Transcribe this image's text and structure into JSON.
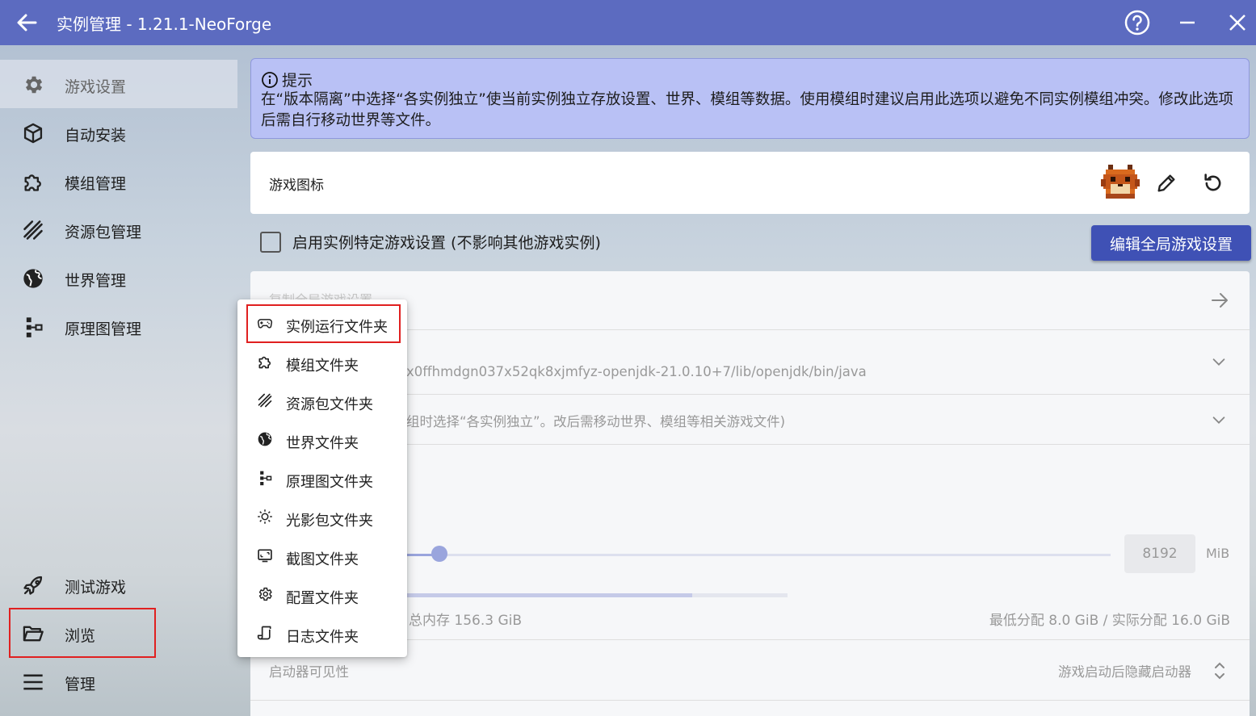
{
  "window": {
    "title": "实例管理 - 1.21.1-NeoForge",
    "icons": {
      "back": "arrow-left-icon",
      "help": "help-circle-icon",
      "minimize": "minimize-icon",
      "close": "close-icon"
    }
  },
  "sidebar": {
    "items": [
      {
        "label": "游戏设置",
        "icon": "gear-icon",
        "active": true
      },
      {
        "label": "自动安装",
        "icon": "cube-icon"
      },
      {
        "label": "模组管理",
        "icon": "puzzle-icon"
      },
      {
        "label": "资源包管理",
        "icon": "texture-icon"
      },
      {
        "label": "世界管理",
        "icon": "globe-icon"
      },
      {
        "label": "原理图管理",
        "icon": "schematic-icon"
      }
    ],
    "bottom_items": [
      {
        "label": "测试游戏",
        "icon": "rocket-icon"
      },
      {
        "label": "浏览",
        "icon": "folder-open-icon",
        "highlighted": true
      },
      {
        "label": "管理",
        "icon": "menu-icon"
      }
    ]
  },
  "hint": {
    "title": "提示",
    "text": "在“版本隔离”中选择“各实例独立”使当前实例独立存放设置、世界、模组等数据。使用模组时建议启用此选项以避免不同实例模组冲突。修改此选项后需自行移动世界等文件。"
  },
  "game_icon": {
    "label": "游戏图标"
  },
  "instance_settings": {
    "checkbox_label": "启用实例特定游戏设置 (不影响其他游戏实例)",
    "checked": false,
    "global_button": "编辑全局游戏设置"
  },
  "main_panel": {
    "copy_global_label": "复制全局游戏设置",
    "java_path": "x0ffhmdgn037x52qk8xjmfyz-openjdk-21.0.10+7/lib/openjdk/bin/java",
    "isolation_text": "组时选择“各实例独立”。改后需移动世界、模组等相关游戏文件)",
    "memory_value": "8192",
    "memory_unit": "MiB",
    "memory_total": "总内存 156.3 GiB",
    "memory_alloc": "最低分配 8.0 GiB / 实际分配 16.0 GiB",
    "launcher_visibility_label": "启动器可见性",
    "launcher_visibility_value": "游戏启动后隐藏启动器"
  },
  "browse_menu": {
    "items": [
      {
        "label": "实例运行文件夹",
        "icon": "gamepad-icon",
        "highlighted": true
      },
      {
        "label": "模组文件夹",
        "icon": "puzzle-icon"
      },
      {
        "label": "资源包文件夹",
        "icon": "texture-icon"
      },
      {
        "label": "世界文件夹",
        "icon": "globe-icon"
      },
      {
        "label": "原理图文件夹",
        "icon": "schematic-icon"
      },
      {
        "label": "光影包文件夹",
        "icon": "sun-icon"
      },
      {
        "label": "截图文件夹",
        "icon": "screenshot-icon"
      },
      {
        "label": "配置文件夹",
        "icon": "cog-icon"
      },
      {
        "label": "日志文件夹",
        "icon": "log-icon"
      }
    ]
  },
  "colors": {
    "titlebar": "#5c6bc0",
    "accent": "#3f51b5",
    "hint_bg": "#b9c1f5",
    "highlight_box": "#e02020"
  }
}
